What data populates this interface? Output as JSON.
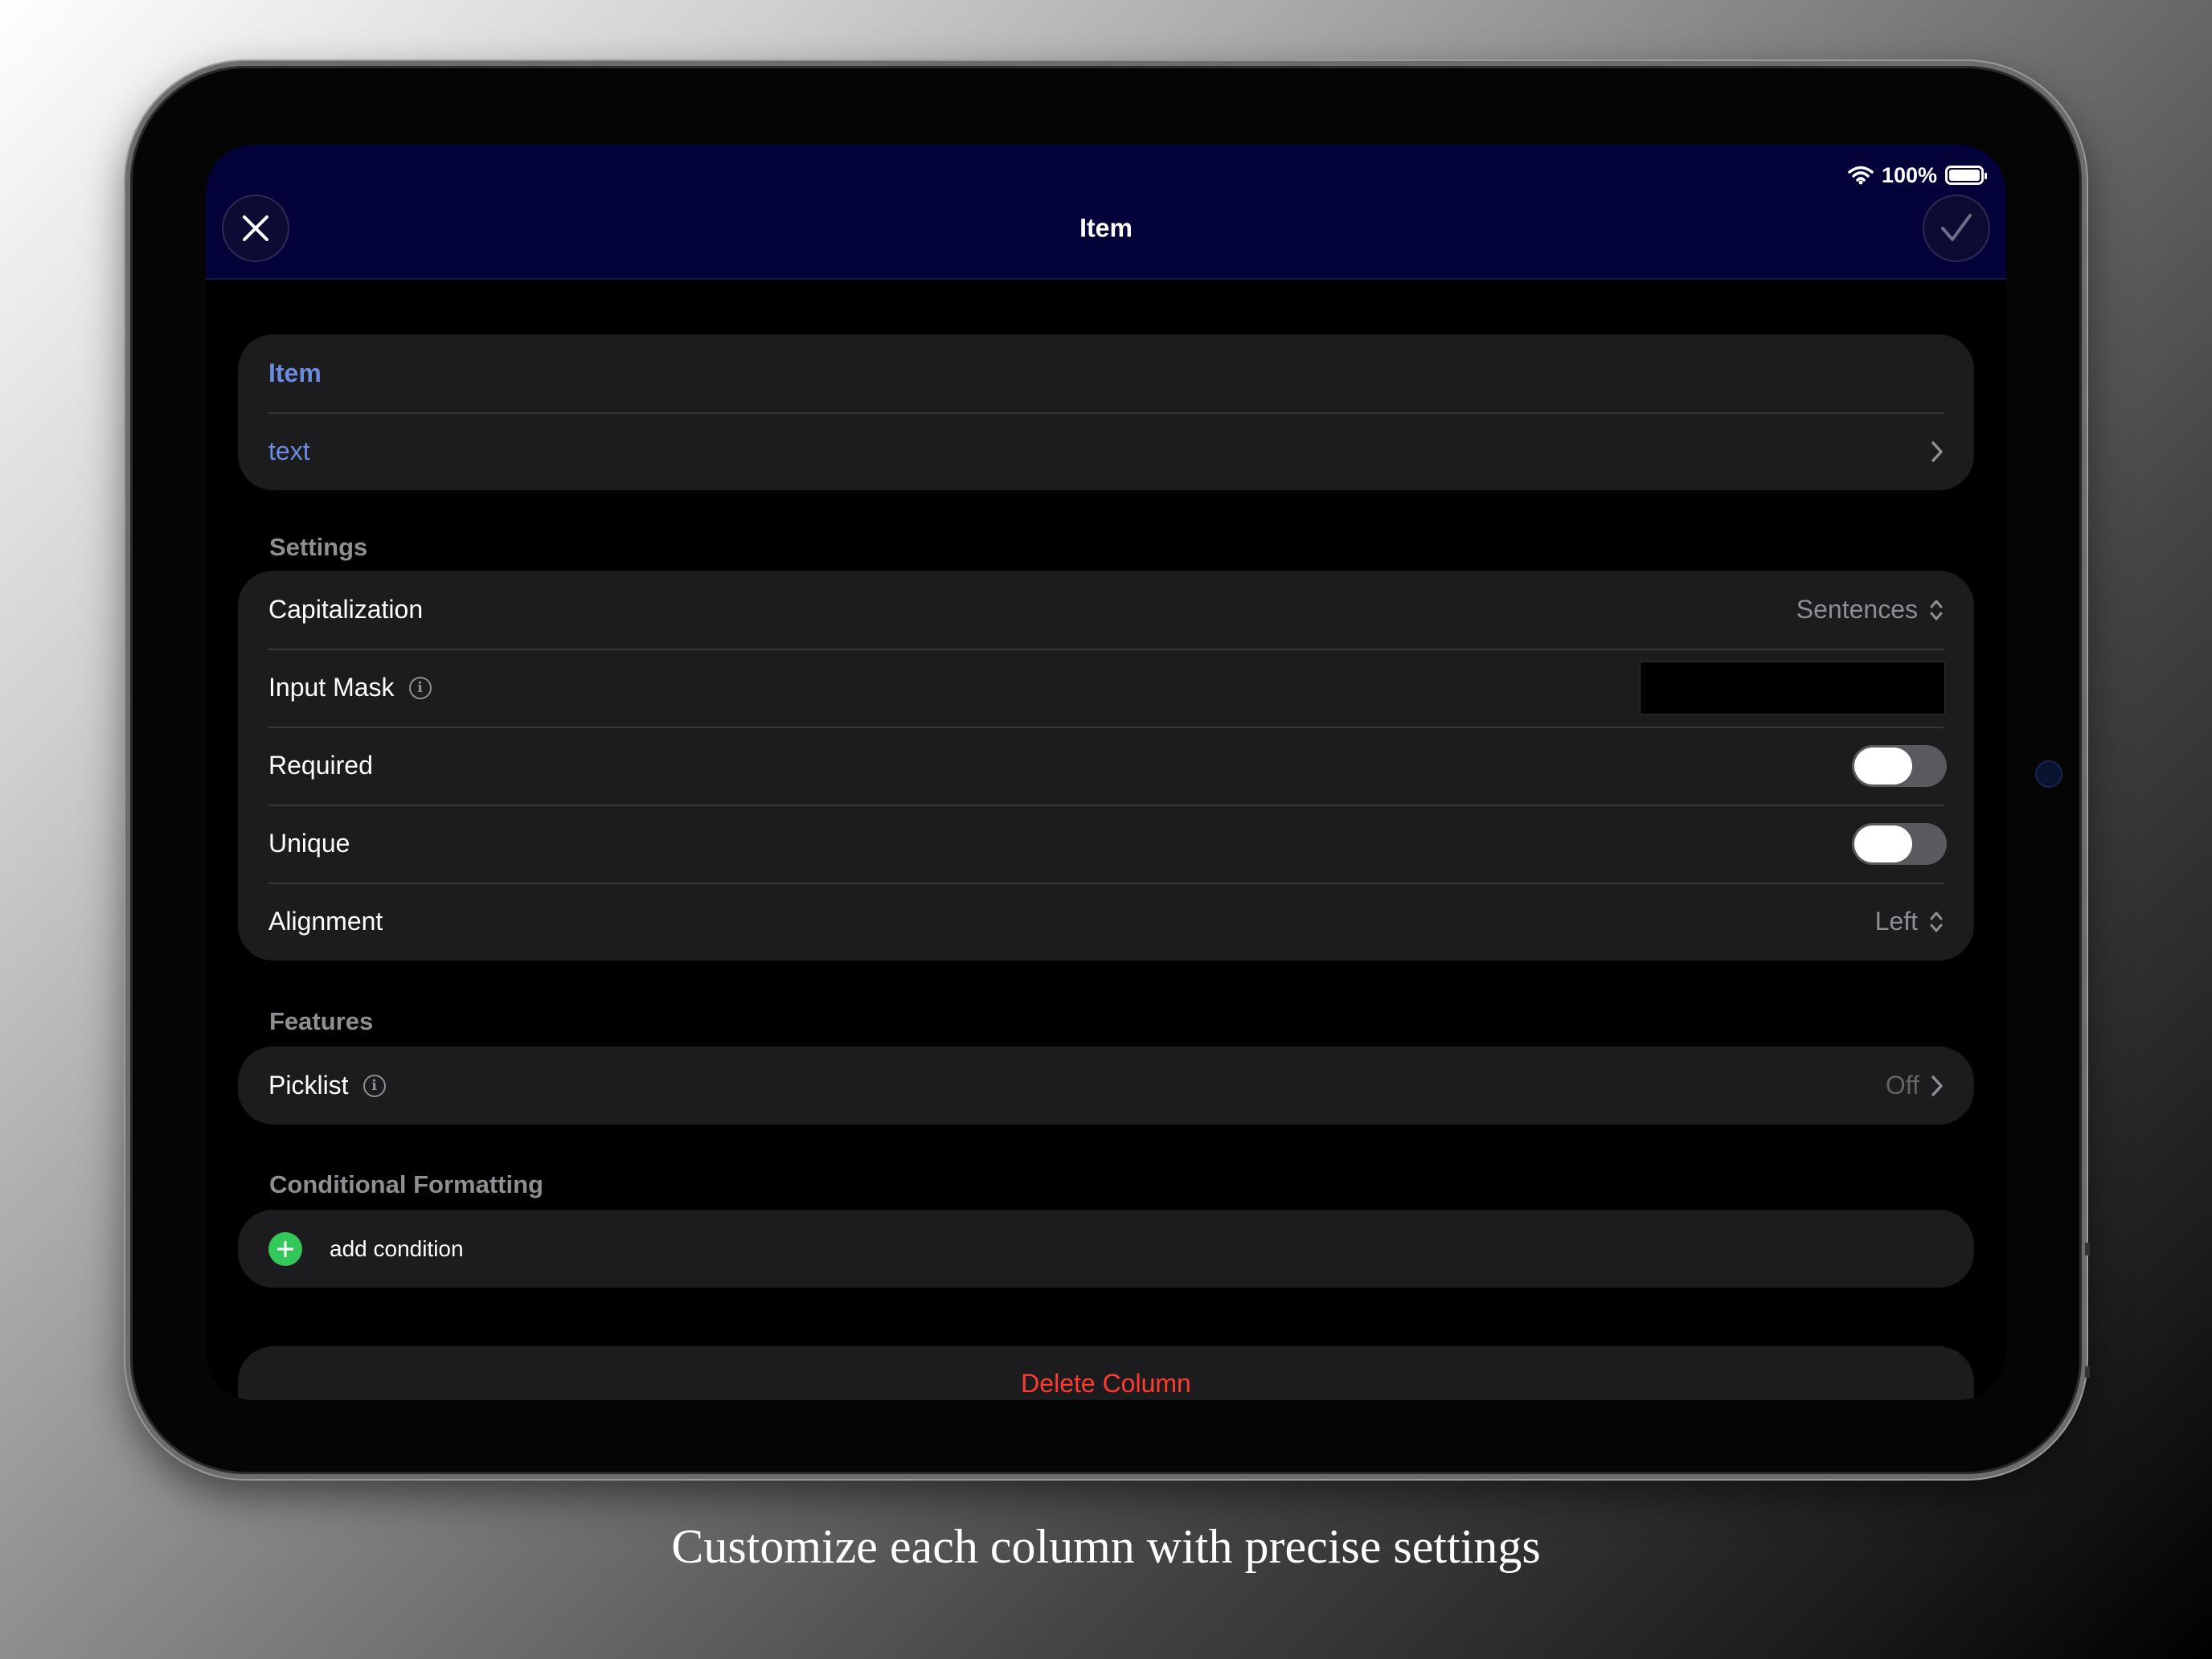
{
  "status_bar": {
    "battery_percent": "100%"
  },
  "navbar": {
    "title": "Item",
    "close_icon": "close-icon",
    "confirm_icon": "checkmark-icon"
  },
  "name_group": {
    "name": "Item",
    "type": "text"
  },
  "settings": {
    "section_label": "Settings",
    "capitalization": {
      "label": "Capitalization",
      "value": "Sentences"
    },
    "input_mask": {
      "label": "Input Mask",
      "value": ""
    },
    "required": {
      "label": "Required",
      "on": false
    },
    "unique": {
      "label": "Unique",
      "on": false
    },
    "alignment": {
      "label": "Alignment",
      "value": "Left"
    }
  },
  "features": {
    "section_label": "Features",
    "picklist": {
      "label": "Picklist",
      "value": "Off"
    }
  },
  "conditional_formatting": {
    "section_label": "Conditional Formatting",
    "add_label": "add condition"
  },
  "delete_label": "Delete Column",
  "caption": "Customize each column with precise settings",
  "colors": {
    "navbar_bg": "#03033a",
    "accent_blue": "#6b8bde",
    "destructive": "#ff3b30",
    "add_green": "#34c759",
    "cell_bg": "#1c1c1e"
  }
}
